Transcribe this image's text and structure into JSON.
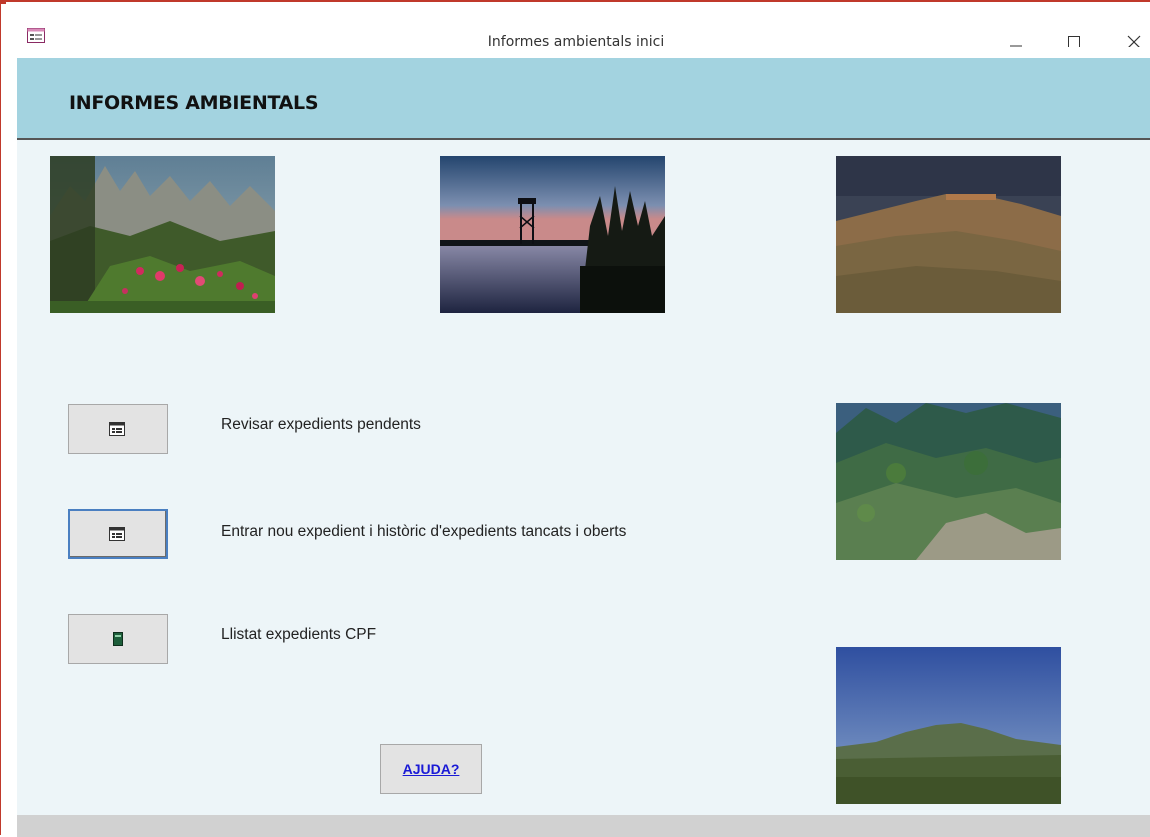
{
  "window": {
    "title": "Informes ambientals inici",
    "controls": [
      "minimize",
      "maximize",
      "close"
    ]
  },
  "header": {
    "title": "INFORMES AMBIENTALS"
  },
  "photos": [
    {
      "name": "mountain-flowers-photo",
      "description_icon": "landscape-image"
    },
    {
      "name": "lake-tower-sunset-photo",
      "description_icon": "landscape-image"
    },
    {
      "name": "rocky-hill-photo",
      "description_icon": "landscape-image"
    },
    {
      "name": "green-hillside-photo",
      "description_icon": "landscape-image"
    },
    {
      "name": "distant-mountain-photo",
      "description_icon": "landscape-image"
    }
  ],
  "actions": [
    {
      "label": "Revisar expedients pendents",
      "icon": "form-icon"
    },
    {
      "label": "Entrar nou expedient i històric d'expedients tancats i oberts",
      "icon": "form-icon"
    },
    {
      "label": "Llistat expedients CPF",
      "icon": "report-book-icon"
    }
  ],
  "help": {
    "label": "AJUDA?"
  },
  "colors": {
    "header_bg": "#a3d3e0",
    "content_bg": "#edf5f8",
    "link": "#1a1ad6",
    "focus_border": "#4a7fc1"
  }
}
